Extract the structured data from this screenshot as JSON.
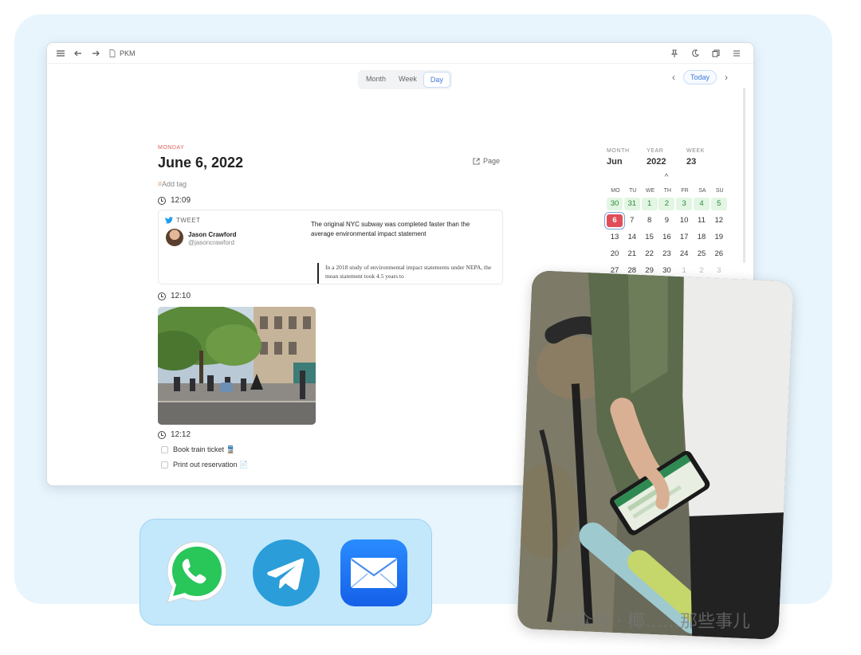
{
  "window": {
    "title": "PKM",
    "icons": [
      "menu-icon",
      "back-arrow-icon",
      "forward-arrow-icon",
      "doc-icon",
      "pin-icon",
      "moon-icon",
      "copy-icon",
      "more-icon"
    ]
  },
  "view_switch": {
    "month": "Month",
    "week": "Week",
    "day": "Day",
    "active": "Day"
  },
  "nav": {
    "today": "Today",
    "prev": "‹",
    "next": "›"
  },
  "journal": {
    "weekday": "MONDAY",
    "date": "June 6, 2022",
    "add_tag_hash": "#",
    "add_tag": "Add tag",
    "page_link": "Page",
    "entries": [
      {
        "time": "12:09"
      },
      {
        "time": "12:10"
      },
      {
        "time": "12:12"
      }
    ],
    "tweet": {
      "label": "TWEET",
      "name": "Jason Crawford",
      "handle": "@jasoncrawford",
      "text": "The original NYC subway was completed faster than the average environmental impact statement",
      "quote": "In a 2018 study of environmental impact statements under NEPA, the mean statement took 4.5 years to"
    },
    "tasks": [
      {
        "label": "Book train ticket 🚆",
        "checked": false
      },
      {
        "label": "Print out reservation 📄",
        "checked": false
      }
    ]
  },
  "calendar": {
    "month_label": "MONTH",
    "month": "Jun",
    "year_label": "YEAR",
    "year": "2022",
    "week_label": "WEEK",
    "week": "23",
    "up": "^",
    "down": "v",
    "dow": [
      "MO",
      "TU",
      "WE",
      "TH",
      "FR",
      "SA",
      "SU"
    ],
    "weeks": [
      [
        "30",
        "31",
        "1",
        "2",
        "3",
        "4",
        "5"
      ],
      [
        "6",
        "7",
        "8",
        "9",
        "10",
        "11",
        "12"
      ],
      [
        "13",
        "14",
        "15",
        "16",
        "17",
        "18",
        "19"
      ],
      [
        "20",
        "21",
        "22",
        "23",
        "24",
        "25",
        "26"
      ],
      [
        "27",
        "28",
        "29",
        "30",
        "1",
        "2",
        "3"
      ]
    ]
  },
  "apps": [
    "whatsapp-icon",
    "telegram-icon",
    "mail-icon"
  ],
  "watermark": "公众号 · 椰……那些事儿"
}
